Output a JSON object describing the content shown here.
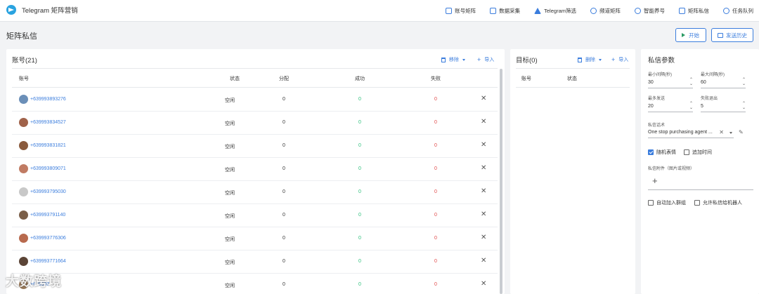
{
  "app": {
    "title": "Telegram 矩阵营销"
  },
  "nav": [
    {
      "label": "账号矩阵",
      "icon": "account-matrix-icon"
    },
    {
      "label": "数据采集",
      "icon": "data-collect-icon"
    },
    {
      "label": "Telegram筛选",
      "icon": "filter-icon"
    },
    {
      "label": "频道矩阵",
      "icon": "channel-icon"
    },
    {
      "label": "智能养号",
      "icon": "smart-nurture-icon"
    },
    {
      "label": "矩阵私信",
      "icon": "message-icon"
    },
    {
      "label": "任务队列",
      "icon": "task-queue-icon"
    }
  ],
  "page": {
    "title": "矩阵私信",
    "start_label": "开始",
    "history_label": "发送历史"
  },
  "accounts": {
    "title": "账号(21)",
    "remove_label": "移除",
    "import_label": "导入",
    "columns": [
      "账号",
      "状态",
      "分配",
      "成功",
      "失败"
    ],
    "rows": [
      {
        "phone": "+639993893276",
        "status": "空闲",
        "alloc": "0",
        "success": "0",
        "fail": "0",
        "avatar_color": "#6b8fb8"
      },
      {
        "phone": "+639993834527",
        "status": "空闲",
        "alloc": "0",
        "success": "0",
        "fail": "0",
        "avatar_color": "#a0624a"
      },
      {
        "phone": "+639993831821",
        "status": "空闲",
        "alloc": "0",
        "success": "0",
        "fail": "0",
        "avatar_color": "#8a5a3c"
      },
      {
        "phone": "+639993809071",
        "status": "空闲",
        "alloc": "0",
        "success": "0",
        "fail": "0",
        "avatar_color": "#c07b63"
      },
      {
        "phone": "+639993795030",
        "status": "空闲",
        "alloc": "0",
        "success": "0",
        "fail": "0",
        "avatar_color": "#c8c8c8"
      },
      {
        "phone": "+639993791140",
        "status": "空闲",
        "alloc": "0",
        "success": "0",
        "fail": "0",
        "avatar_color": "#7a5e48"
      },
      {
        "phone": "+639993776306",
        "status": "空闲",
        "alloc": "0",
        "success": "0",
        "fail": "0",
        "avatar_color": "#b86a4e"
      },
      {
        "phone": "+639993771664",
        "status": "空闲",
        "alloc": "0",
        "success": "0",
        "fail": "0",
        "avatar_color": "#5b4436"
      },
      {
        "phone": "+639993",
        "status": "空闲",
        "alloc": "0",
        "success": "0",
        "fail": "0",
        "avatar_color": "#9a7a5a"
      }
    ]
  },
  "targets": {
    "title": "目标(0)",
    "delete_label": "删除",
    "import_label": "导入",
    "columns": [
      "账号",
      "状态"
    ]
  },
  "params": {
    "title": "私信参数",
    "min_interval_label": "最小间隔(秒)",
    "min_interval": "30",
    "max_interval_label": "最大间隔(秒)",
    "max_interval": "60",
    "max_send_label": "最多发送",
    "max_send": "20",
    "fail_exit_label": "失败退出",
    "fail_exit": "5",
    "script_label": "私信话术",
    "script_value": "One stop purchasing agent ...",
    "random_emoji_label": "随机表情",
    "random_emoji_checked": true,
    "append_time_label": "追加时间",
    "append_time_checked": false,
    "attachment_label": "私信附件（图片或视频）",
    "auto_join_label": "自动加入群组",
    "allow_bot_label": "允许私信给机器人"
  },
  "watermark": "大数跨境",
  "colors": {
    "accent": "#3b7ddd",
    "success": "#2bbf7a",
    "fail": "#e04848"
  }
}
